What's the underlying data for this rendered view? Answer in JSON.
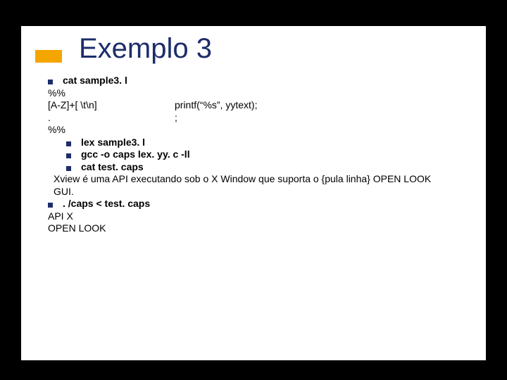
{
  "title": "Exemplo 3",
  "bullets": {
    "cat": "cat sample3. l",
    "lex": "lex sample3. l",
    "gcc": "gcc -o caps lex. yy. c -ll",
    "cat_test": "cat test. caps",
    "run": ". /caps < test. caps"
  },
  "code": {
    "delim1": "%%",
    "pat1_left": "[A-Z]+[ \\t\\n]",
    "pat1_right": "printf(“%s”, yytext);",
    "pat2_left": ".",
    "pat2_right": ";",
    "delim2": "%%"
  },
  "paragraph": "Xview é uma API executando sob o X Window que suporta o {pula linha} OPEN LOOK GUI.",
  "output": {
    "line1": "API X",
    "line2": "OPEN LOOK"
  }
}
